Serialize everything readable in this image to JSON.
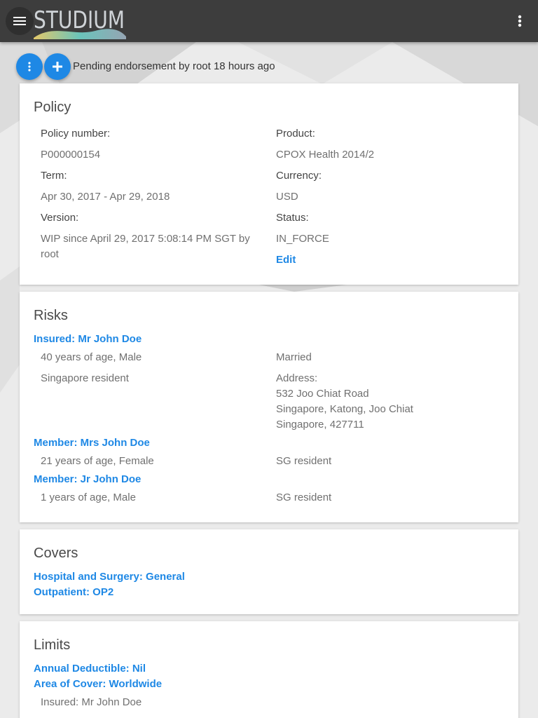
{
  "header": {
    "logo_text": "STUDIUM",
    "menu_icon": "menu-icon",
    "more_icon": "more-vert-icon"
  },
  "actions": {
    "more_icon": "more-vert-icon",
    "add_icon": "plus-icon",
    "status": "Pending endorsement by root 18 hours ago"
  },
  "policy": {
    "title": "Policy",
    "policy_number_label": "Policy number:",
    "policy_number": "P000000154",
    "product_label": "Product:",
    "product": "CPOX Health 2014/2",
    "term_label": "Term:",
    "term": "Apr 30, 2017 - Apr 29, 2018",
    "currency_label": "Currency:",
    "currency": "USD",
    "version_label": "Version:",
    "version": "WIP since April 29, 2017 5:08:14 PM SGT by root",
    "status_label": "Status:",
    "status": "IN_FORCE",
    "edit": "Edit"
  },
  "risks": {
    "title": "Risks",
    "insured": {
      "heading": "Insured: Mr John Doe",
      "age": "40 years of age, Male",
      "marital": "Married",
      "residency": "Singapore resident",
      "address_label": "Address:",
      "address_line1": "532 Joo Chiat Road",
      "address_line2": "Singapore, Katong, Joo Chiat",
      "address_line3": "Singapore, 427711"
    },
    "members": [
      {
        "heading": "Member: Mrs John Doe",
        "age": "21 years of age, Female",
        "residency": "SG resident"
      },
      {
        "heading": "Member: Jr John Doe",
        "age": "1 years of age, Male",
        "residency": "SG resident"
      }
    ]
  },
  "covers": {
    "title": "Covers",
    "items": [
      "Hospital and Surgery: General",
      "Outpatient: OP2"
    ]
  },
  "limits": {
    "title": "Limits",
    "items": [
      "Annual Deductible: Nil",
      "Area of Cover: Worldwide"
    ],
    "insured": "Insured: Mr John Doe"
  },
  "colors": {
    "accent": "#1e88e5",
    "header_bg": "#3d3d3d",
    "page_bg": "#ebebeb"
  }
}
